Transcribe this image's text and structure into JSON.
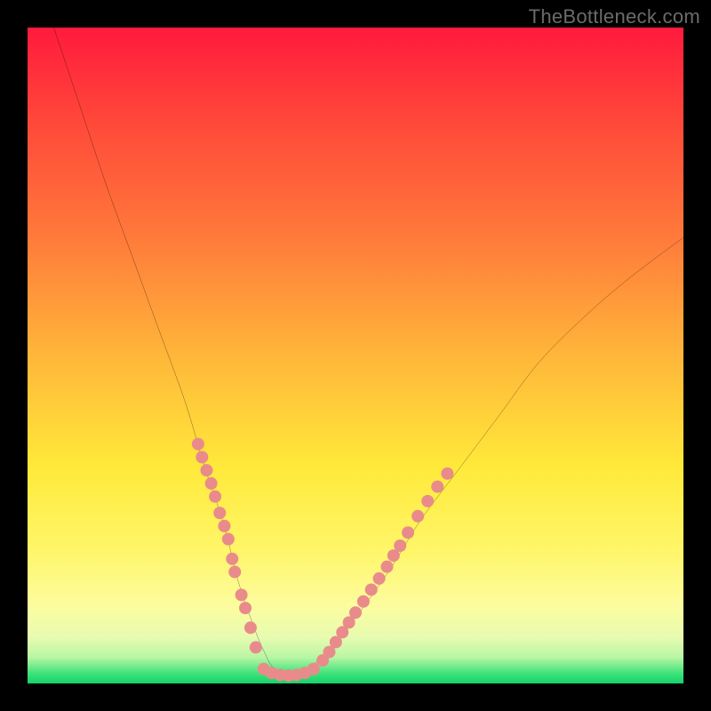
{
  "watermark": "TheBottleneck.com",
  "chart_data": {
    "type": "line",
    "title": "",
    "xlabel": "",
    "ylabel": "",
    "xlim": [
      0,
      100
    ],
    "ylim": [
      0,
      100
    ],
    "series": [
      {
        "name": "bottleneck-curve",
        "x": [
          4,
          8,
          12,
          16,
          20,
          24,
          27,
          30,
          32,
          34,
          36,
          38,
          42,
          46,
          50,
          55,
          60,
          66,
          72,
          78,
          85,
          92,
          100
        ],
        "y": [
          100,
          88,
          76,
          65,
          54,
          43,
          33,
          24,
          16,
          10,
          5,
          2,
          2,
          5,
          10,
          17,
          25,
          33,
          41,
          49,
          56,
          62,
          68
        ]
      },
      {
        "name": "highlight-dots-left",
        "x": [
          26.0,
          26.6,
          27.3,
          28.0,
          28.6,
          29.3,
          30.0,
          30.6,
          31.2,
          31.6,
          32.6,
          33.2,
          34.0,
          34.8
        ],
        "y": [
          36.5,
          34.5,
          32.5,
          30.5,
          28.5,
          26.0,
          24.0,
          22.0,
          19.0,
          17.0,
          13.5,
          11.5,
          8.5,
          5.5
        ]
      },
      {
        "name": "highlight-dots-bottom",
        "x": [
          36.0,
          37.2,
          38.5,
          39.8,
          41.0,
          42.3,
          43.6
        ],
        "y": [
          2.2,
          1.6,
          1.3,
          1.2,
          1.3,
          1.6,
          2.2
        ]
      },
      {
        "name": "highlight-dots-right",
        "x": [
          45.0,
          46.0,
          47.0,
          48.0,
          49.0,
          50.0,
          51.2,
          52.4,
          53.6,
          54.8,
          55.8,
          56.8,
          58.0,
          59.5,
          61.0,
          62.5,
          64.0
        ],
        "y": [
          3.5,
          4.8,
          6.3,
          7.8,
          9.3,
          10.8,
          12.5,
          14.3,
          16.0,
          17.8,
          19.5,
          21.0,
          23.0,
          25.5,
          27.8,
          30.0,
          32.0
        ]
      }
    ],
    "colors": {
      "curve_stroke": "#000000",
      "dot_fill": "#e98b8b"
    }
  }
}
